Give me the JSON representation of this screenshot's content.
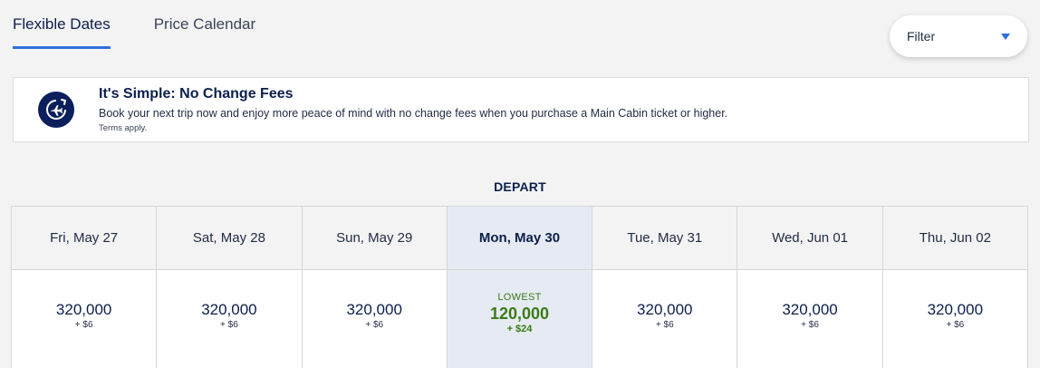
{
  "tabs": [
    {
      "label": "Flexible Dates",
      "active": true
    },
    {
      "label": "Price Calendar",
      "active": false
    }
  ],
  "filter": {
    "label": "Filter",
    "icon": "chevron-down-icon"
  },
  "banner": {
    "icon": "airplane-clock-icon",
    "title": "It's Simple: No Change Fees",
    "text": "Book your next trip now and enjoy more peace of mind with no change fees when you purchase a Main Cabin ticket or higher.",
    "terms": "Terms apply."
  },
  "depart_label": "DEPART",
  "dates": [
    {
      "day": "Fri, May 27",
      "price": "320,000",
      "tax": "+ $6",
      "selected": false,
      "tag": ""
    },
    {
      "day": "Sat, May 28",
      "price": "320,000",
      "tax": "+ $6",
      "selected": false,
      "tag": ""
    },
    {
      "day": "Sun, May 29",
      "price": "320,000",
      "tax": "+ $6",
      "selected": false,
      "tag": ""
    },
    {
      "day": "Mon, May 30",
      "price": "120,000",
      "tax": "+ $24",
      "selected": true,
      "tag": "LOWEST"
    },
    {
      "day": "Tue, May 31",
      "price": "320,000",
      "tax": "+ $6",
      "selected": false,
      "tag": ""
    },
    {
      "day": "Wed, Jun 01",
      "price": "320,000",
      "tax": "+ $6",
      "selected": false,
      "tag": ""
    },
    {
      "day": "Thu, Jun 02",
      "price": "320,000",
      "tax": "+ $6",
      "selected": false,
      "tag": ""
    }
  ],
  "colors": {
    "accent": "#2f6fdc",
    "navy": "#0b1f5c",
    "lowest_green": "#3a7a14",
    "selected_bg": "#e6ebf3"
  }
}
